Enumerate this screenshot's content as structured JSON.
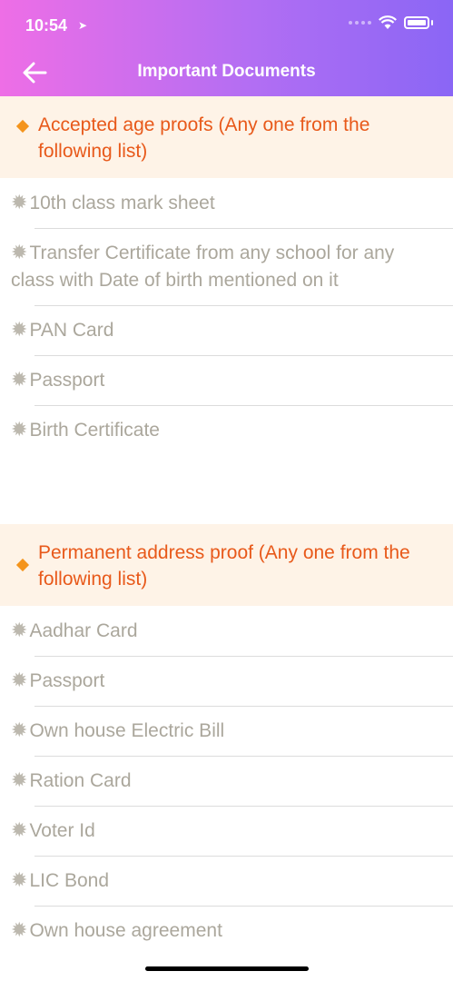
{
  "status_bar": {
    "time": "10:54"
  },
  "header": {
    "title": "Important Documents"
  },
  "sections": [
    {
      "title": "Accepted age proofs (Any one from the following list)",
      "items": [
        "10th class mark sheet",
        "Transfer Certificate from any school for any class with Date of birth mentioned on it",
        "PAN Card",
        "Passport",
        "Birth Certificate"
      ]
    },
    {
      "title": "Permanent address proof (Any one from the following list)",
      "items": [
        "Aadhar Card",
        "Passport",
        "Own house Electric Bill",
        "Ration Card",
        "Voter Id",
        "LIC Bond",
        "Own house agreement"
      ]
    }
  ],
  "icons": {
    "back": "arrow-left-icon",
    "section_marker": "diamond-icon",
    "item_marker": "star-icon"
  },
  "colors": {
    "header_gradient_start": "#ee6ee6",
    "header_gradient_end": "#8a66f5",
    "section_bg": "#fef3e7",
    "section_text": "#e8591a",
    "diamond": "#f4941c",
    "item_text": "#aba79c"
  }
}
